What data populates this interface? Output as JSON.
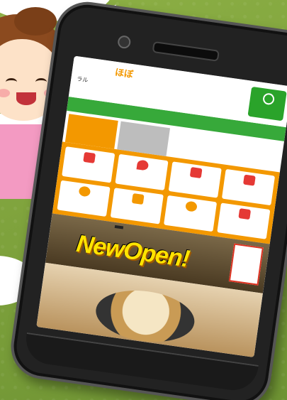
{
  "phone_screen": {
    "logo": "ほぼ",
    "store_name_line1": "ラル",
    "store_name_line2": "",
    "menu_button": "",
    "green_bar": "",
    "tabs": [
      {
        "label": "",
        "state": "active"
      },
      {
        "label": "",
        "state": "inactive"
      }
    ],
    "grid_items": [
      {
        "label": "",
        "color": "#e53935"
      },
      {
        "label": "",
        "color": "#e53935"
      },
      {
        "label": "",
        "color": "#e53935"
      },
      {
        "label": "",
        "color": "#e53935"
      },
      {
        "label": "",
        "color": "#f39800"
      },
      {
        "label": "",
        "color": "#f39800"
      },
      {
        "label": "",
        "color": "#f39800"
      },
      {
        "label": "",
        "color": "#e53935"
      }
    ],
    "banner_tag": "",
    "banner_headline": "NewOpen!",
    "banner_badge": "",
    "food_label": ""
  },
  "colors": {
    "background_green": "#7fa23a",
    "accent_orange": "#f39800",
    "accent_green": "#37a93a",
    "phone_body": "#222222"
  }
}
